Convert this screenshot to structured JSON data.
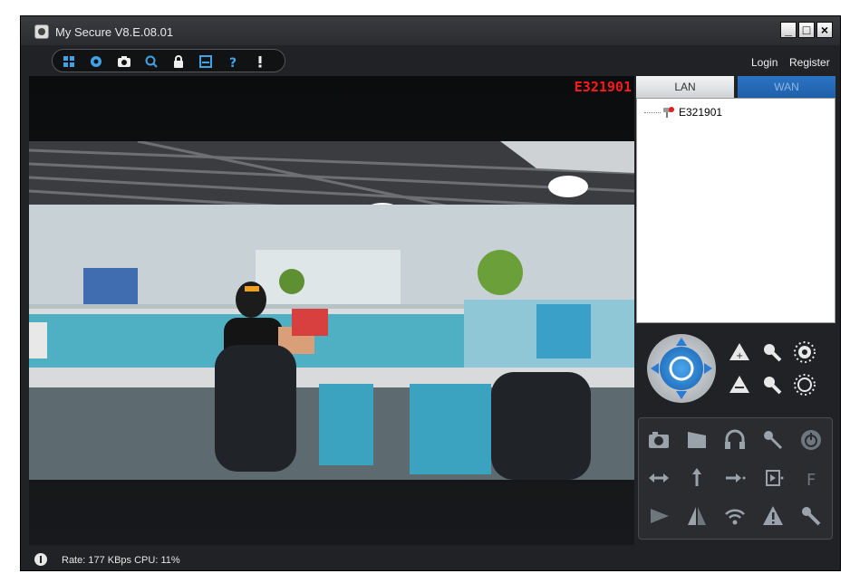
{
  "window": {
    "title": "My Secure  V8.E.08.01",
    "minimize_label": "_",
    "maximize_label": "□",
    "close_label": "×"
  },
  "toolbar": {
    "tools": [
      "grid-icon",
      "record-icon",
      "snapshot-icon",
      "search-icon",
      "lock-icon",
      "save-icon",
      "help-icon",
      "alert-icon"
    ],
    "login_label": "Login",
    "register_label": "Register"
  },
  "video": {
    "camera_label": "E321901"
  },
  "tabs": {
    "lan_label": "LAN",
    "wan_label": "WAN"
  },
  "device_list": [
    {
      "name": "E321901"
    }
  ],
  "ptz": {
    "buttons": [
      "direction-pad-icon",
      "zoom-in-icon",
      "zoom-out-icon",
      "focus-near-icon",
      "focus-far-icon",
      "iris-open-icon",
      "iris-close-icon"
    ]
  },
  "controls": {
    "buttons": [
      "camera-snapshot-icon",
      "video-clip-icon",
      "headphones-icon",
      "microphone-icon",
      "power-icon",
      "horizontal-flip-icon",
      "vertical-flip-icon",
      "cruise-icon",
      "input-icon",
      "flip-label-icon",
      "play-icon",
      "mirror-icon",
      "wifi-icon",
      "warning-icon",
      "settings-wrench-icon"
    ]
  },
  "status": {
    "text": "Rate: 177 KBps  CPU:  11%"
  },
  "colors": {
    "window_bg": "#202225",
    "accent_blue": "#2a7bd6",
    "camera_label": "#ff1a1a",
    "wan_tab": "#1f5fa8"
  }
}
